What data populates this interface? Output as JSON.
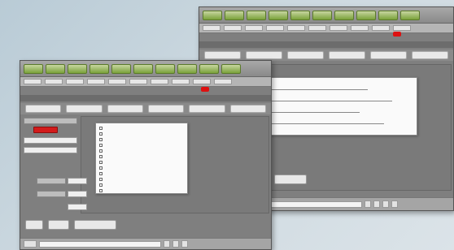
{
  "back_window": {
    "tabs": [
      "",
      "",
      "",
      "",
      "",
      ""
    ],
    "popup_items": [
      "",
      "",
      "",
      "",
      "",
      "",
      "",
      "",
      ""
    ],
    "status_buttons": [
      "",
      "",
      "",
      ""
    ],
    "left_button": ""
  },
  "front_window": {
    "title": "",
    "tabs": [
      "",
      "",
      "",
      "",
      "",
      ""
    ],
    "popup_items": [
      "",
      "",
      "",
      "",
      "",
      "",
      "",
      "",
      "",
      "",
      "",
      ""
    ],
    "side_labels": [
      "",
      "",
      ""
    ],
    "bottom_buttons": [
      "",
      "",
      ""
    ],
    "status_buttons": [
      "",
      "",
      ""
    ],
    "status_field": ""
  },
  "colors": {
    "desktop_bg": "#c6d4dc",
    "window_body": "#7f7f7f",
    "toolbar_green": "#7aa23a",
    "alert_red": "#d11111"
  }
}
